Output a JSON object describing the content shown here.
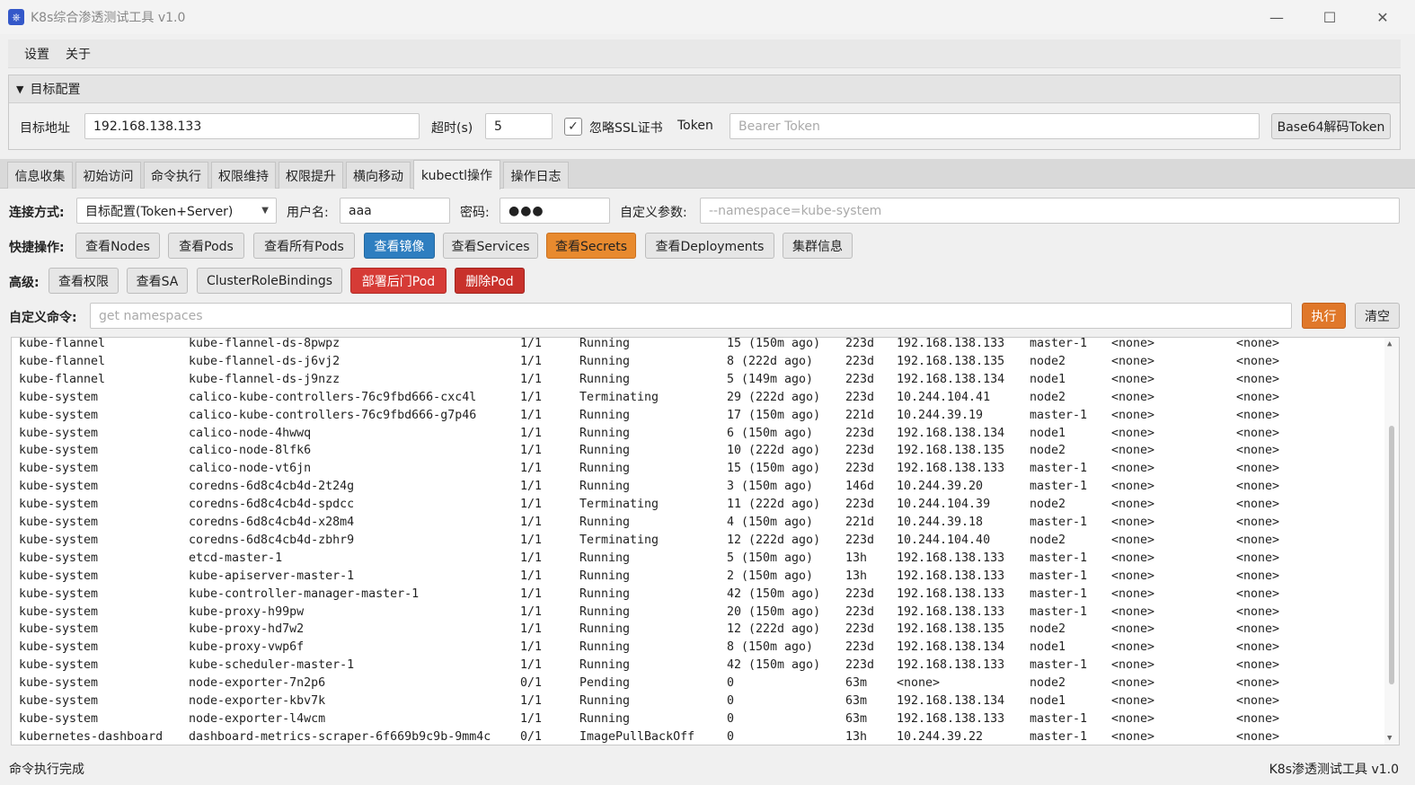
{
  "window": {
    "title": "K8s综合渗透测试工具 v1.0",
    "app_icon": "kubernetes-icon",
    "minimize_glyph": "—",
    "maximize_glyph": "☐",
    "close_glyph": "✕"
  },
  "menu": [
    "设置",
    "关于"
  ],
  "target_config": {
    "header": "目标配置",
    "address_label": "目标地址",
    "address_value": "192.168.138.133",
    "timeout_label": "超时(s)",
    "timeout_value": "5",
    "ignore_ssl_label": "忽略SSL证书",
    "ignore_ssl_checked": true,
    "token_label": "Token",
    "token_placeholder": "Bearer Token",
    "decode_button": "Base64解码Token"
  },
  "tabs": [
    "信息收集",
    "初始访问",
    "命令执行",
    "权限维持",
    "权限提升",
    "横向移动",
    "kubectl操作",
    "操作日志"
  ],
  "active_tab": "kubectl操作",
  "kubectl": {
    "connect_label": "连接方式:",
    "connect_value": "目标配置(Token+Server)",
    "username_label": "用户名:",
    "username_value": "aaa",
    "password_label": "密码:",
    "password_value": "●●●",
    "custom_params_label": "自定义参数:",
    "custom_params_placeholder": "--namespace=kube-system",
    "quick_label": "快捷操作:",
    "quick_buttons": [
      "查看Nodes",
      "查看Pods",
      "查看所有Pods",
      "查看镜像",
      "查看Services",
      "查看Secrets",
      "查看Deployments",
      "集群信息"
    ],
    "advanced_label": "高级:",
    "advanced_buttons": [
      "查看权限",
      "查看SA",
      "ClusterRoleBindings",
      "部署后门Pod",
      "删除Pod"
    ],
    "custom_cmd_label": "自定义命令:",
    "custom_cmd_placeholder": "get namespaces",
    "execute_button": "执行",
    "clear_button": "清空"
  },
  "output_rows": [
    [
      "kube-flannel",
      "kube-flannel-ds-8pwpz",
      "1/1",
      "Running",
      "15 (150m ago)",
      "223d",
      "192.168.138.133",
      "master-1",
      "<none>",
      "<none>"
    ],
    [
      "kube-flannel",
      "kube-flannel-ds-j6vj2",
      "1/1",
      "Running",
      "8 (222d ago)",
      "223d",
      "192.168.138.135",
      "node2",
      "<none>",
      "<none>"
    ],
    [
      "kube-flannel",
      "kube-flannel-ds-j9nzz",
      "1/1",
      "Running",
      "5 (149m ago)",
      "223d",
      "192.168.138.134",
      "node1",
      "<none>",
      "<none>"
    ],
    [
      "kube-system",
      "calico-kube-controllers-76c9fbd666-cxc4l",
      "1/1",
      "Terminating",
      "29 (222d ago)",
      "223d",
      "10.244.104.41",
      "node2",
      "<none>",
      "<none>"
    ],
    [
      "kube-system",
      "calico-kube-controllers-76c9fbd666-g7p46",
      "1/1",
      "Running",
      "17 (150m ago)",
      "221d",
      "10.244.39.19",
      "master-1",
      "<none>",
      "<none>"
    ],
    [
      "kube-system",
      "calico-node-4hwwq",
      "1/1",
      "Running",
      "6 (150m ago)",
      "223d",
      "192.168.138.134",
      "node1",
      "<none>",
      "<none>"
    ],
    [
      "kube-system",
      "calico-node-8lfk6",
      "1/1",
      "Running",
      "10 (222d ago)",
      "223d",
      "192.168.138.135",
      "node2",
      "<none>",
      "<none>"
    ],
    [
      "kube-system",
      "calico-node-vt6jn",
      "1/1",
      "Running",
      "15 (150m ago)",
      "223d",
      "192.168.138.133",
      "master-1",
      "<none>",
      "<none>"
    ],
    [
      "kube-system",
      "coredns-6d8c4cb4d-2t24g",
      "1/1",
      "Running",
      "3 (150m ago)",
      "146d",
      "10.244.39.20",
      "master-1",
      "<none>",
      "<none>"
    ],
    [
      "kube-system",
      "coredns-6d8c4cb4d-spdcc",
      "1/1",
      "Terminating",
      "11 (222d ago)",
      "223d",
      "10.244.104.39",
      "node2",
      "<none>",
      "<none>"
    ],
    [
      "kube-system",
      "coredns-6d8c4cb4d-x28m4",
      "1/1",
      "Running",
      "4 (150m ago)",
      "221d",
      "10.244.39.18",
      "master-1",
      "<none>",
      "<none>"
    ],
    [
      "kube-system",
      "coredns-6d8c4cb4d-zbhr9",
      "1/1",
      "Terminating",
      "12 (222d ago)",
      "223d",
      "10.244.104.40",
      "node2",
      "<none>",
      "<none>"
    ],
    [
      "kube-system",
      "etcd-master-1",
      "1/1",
      "Running",
      "5 (150m ago)",
      "13h",
      "192.168.138.133",
      "master-1",
      "<none>",
      "<none>"
    ],
    [
      "kube-system",
      "kube-apiserver-master-1",
      "1/1",
      "Running",
      "2 (150m ago)",
      "13h",
      "192.168.138.133",
      "master-1",
      "<none>",
      "<none>"
    ],
    [
      "kube-system",
      "kube-controller-manager-master-1",
      "1/1",
      "Running",
      "42 (150m ago)",
      "223d",
      "192.168.138.133",
      "master-1",
      "<none>",
      "<none>"
    ],
    [
      "kube-system",
      "kube-proxy-h99pw",
      "1/1",
      "Running",
      "20 (150m ago)",
      "223d",
      "192.168.138.133",
      "master-1",
      "<none>",
      "<none>"
    ],
    [
      "kube-system",
      "kube-proxy-hd7w2",
      "1/1",
      "Running",
      "12 (222d ago)",
      "223d",
      "192.168.138.135",
      "node2",
      "<none>",
      "<none>"
    ],
    [
      "kube-system",
      "kube-proxy-vwp6f",
      "1/1",
      "Running",
      "8 (150m ago)",
      "223d",
      "192.168.138.134",
      "node1",
      "<none>",
      "<none>"
    ],
    [
      "kube-system",
      "kube-scheduler-master-1",
      "1/1",
      "Running",
      "42 (150m ago)",
      "223d",
      "192.168.138.133",
      "master-1",
      "<none>",
      "<none>"
    ],
    [
      "kube-system",
      "node-exporter-7n2p6",
      "0/1",
      "Pending",
      "0",
      "63m",
      "<none>",
      "node2",
      "<none>",
      "<none>"
    ],
    [
      "kube-system",
      "node-exporter-kbv7k",
      "1/1",
      "Running",
      "0",
      "63m",
      "192.168.138.134",
      "node1",
      "<none>",
      "<none>"
    ],
    [
      "kube-system",
      "node-exporter-l4wcm",
      "1/1",
      "Running",
      "0",
      "63m",
      "192.168.138.133",
      "master-1",
      "<none>",
      "<none>"
    ],
    [
      "kubernetes-dashboard",
      "dashboard-metrics-scraper-6f669b9c9b-9mm4c",
      "0/1",
      "ImagePullBackOff",
      "0",
      "13h",
      "10.244.39.22",
      "master-1",
      "<none>",
      "<none>"
    ]
  ],
  "status": {
    "left": "命令执行完成",
    "right": "K8s渗透测试工具 v1.0"
  },
  "colors": {
    "blue_button": "#2e7ec0",
    "orange_button": "#e0782a",
    "red_button": "#d63b36"
  }
}
